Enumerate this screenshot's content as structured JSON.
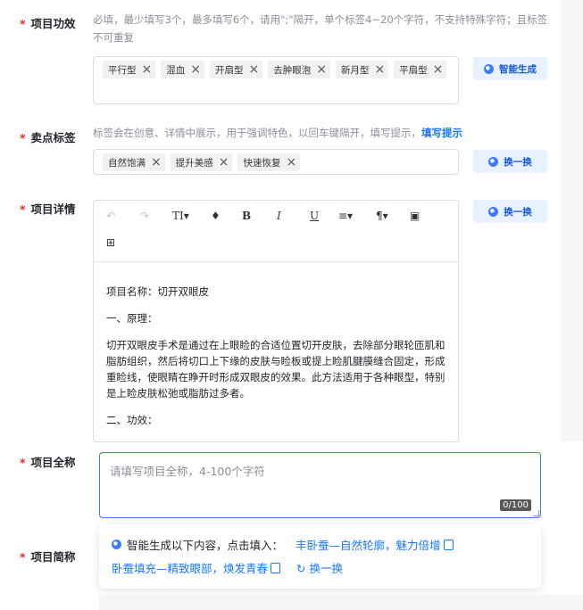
{
  "required_mark": "*",
  "efficacy": {
    "label": "项目功效",
    "hint": "必填，最少填写3个，最多填写6个，请用\";\"隔开，单个标签4~20个字符，不支持特殊字符；且标签不可重复",
    "tags": [
      "平行型",
      "混血",
      "开扇型",
      "去肿眼泡",
      "新月型",
      "平扇型"
    ],
    "ai_button": "智能生成"
  },
  "selling": {
    "label": "卖点标签",
    "hint": "标签会在创意、详情中展示，用于强调特色，以回车键隔开，填写提示，",
    "hint_link": "填写提示",
    "tags": [
      "自然饱满",
      "提升美感",
      "快速恢复"
    ],
    "ai_button": "换一换"
  },
  "detail": {
    "label": "项目详情",
    "ai_button": "换一换",
    "toolbar": {
      "undo": "↶",
      "redo": "↷",
      "text_size": "TI▾",
      "color": "♦",
      "bold": "B",
      "italic": "I",
      "underline": "U",
      "align": "≡▾",
      "paragraph": "¶▾",
      "image": "▣",
      "table": "⊞"
    },
    "paragraphs": [
      "项目名称：切开双眼皮",
      "一、原理：",
      "切开双眼皮手术是通过在上眼睑的合适位置切开皮肤，去除部分眼轮匝肌和脂肪组织，然后将切口上下缘的皮肤与睑板或提上睑肌腱膜缝合固定，形成重睑线，使眼睛在睁开时形成双眼皮的效果。此方法适用于各种眼型，特别是上睑皮肤松弛或脂肪过多者。",
      "二、功效："
    ]
  },
  "fullname": {
    "label": "项目全称",
    "placeholder": "请填写项目全称，4-100个字符",
    "counter": "0/100"
  },
  "shortname": {
    "label": "项目简称"
  },
  "suggestion": {
    "prefix": "智能生成以下内容，点击填入：",
    "options": [
      "丰卧蚕—自然轮廓，魅力倍增",
      "卧蚕填充—精致眼部，焕发青春"
    ],
    "refresh": "换一换"
  }
}
